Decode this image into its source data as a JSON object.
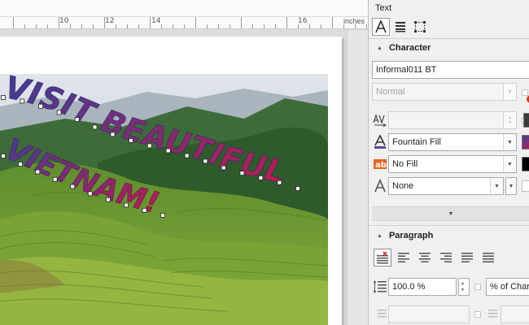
{
  "ruler": {
    "labels": [
      "10",
      "12",
      "14",
      "16"
    ],
    "unit": "inches"
  },
  "artwork": {
    "line1": "VISIT BEAUTIFUL",
    "line2": "VIETNAM!",
    "gradient_start": "#3a3f9a",
    "gradient_end": "#c01a4a"
  },
  "docker": {
    "title": "Text",
    "tabs": [
      "character-tab-icon",
      "paragraph-tab-icon",
      "frame-tab-icon"
    ],
    "character": {
      "header": "Character",
      "font_family": "Informal011 BT",
      "font_style": "Normal",
      "kerning_value": "",
      "fill_type": "Fountain Fill",
      "background_fill": "No Fill",
      "outline": "None",
      "fill_swatch_color": "#3d4a9c",
      "bg_swatch_color": "#000000"
    },
    "paragraph": {
      "header": "Paragraph",
      "line_spacing": "100.0 %",
      "spacing_unit": "% of Char"
    }
  }
}
